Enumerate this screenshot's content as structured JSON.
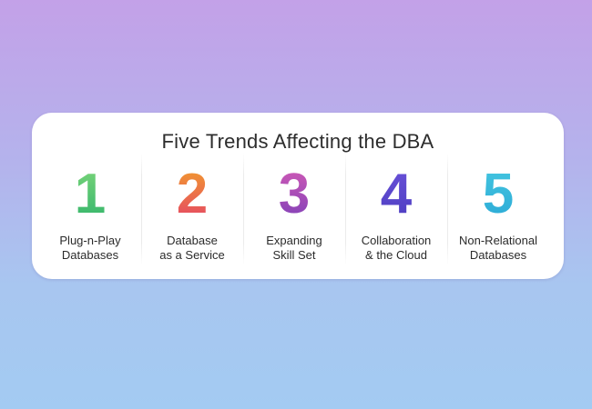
{
  "title": "Five Trends Affecting the DBA",
  "trends": [
    {
      "number": "1",
      "line1": "Plug-n-Play",
      "line2": "Databases"
    },
    {
      "number": "2",
      "line1": "Database",
      "line2": "as a Service"
    },
    {
      "number": "3",
      "line1": "Expanding",
      "line2": "Skill Set"
    },
    {
      "number": "4",
      "line1": "Collaboration",
      "line2": "& the Cloud"
    },
    {
      "number": "5",
      "line1": "Non-Relational",
      "line2": "Databases"
    }
  ],
  "colors": {
    "background_top": "#c3a1e8",
    "background_bottom": "#a3cbf2",
    "numeral_1": "#2fb36b",
    "numeral_2": "#e4406a",
    "numeral_3": "#7a3fb8",
    "numeral_4": "#4a3cbf",
    "numeral_5": "#2aa8d6"
  }
}
